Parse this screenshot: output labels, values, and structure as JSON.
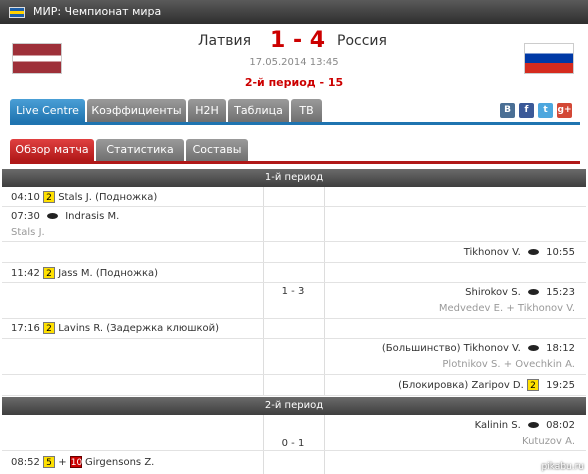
{
  "header": {
    "title": "МИР: Чемпионат мира"
  },
  "match": {
    "home": "Латвия",
    "away": "Россия",
    "score": "1 - 4",
    "datetime": "17.05.2014 13:45",
    "status": "2-й период - 15"
  },
  "tabs": [
    "Live Centre",
    "Коэффициенты",
    "H2H",
    "Таблица",
    "ТВ"
  ],
  "social": [
    "В",
    "f",
    "t",
    "g+"
  ],
  "subtabs": [
    "Обзор матча",
    "Статистика",
    "Составы"
  ],
  "periods": [
    {
      "label": "1-й период",
      "score": "1 - 3",
      "events": [
        {
          "time": "04:10",
          "badge": "2",
          "text": "Stals J. (Подножка)"
        },
        {
          "time": "07:30",
          "text": "Indrasis M.",
          "sub": "Stals J."
        },
        {
          "time": "10:55",
          "text": "Tikhonov V."
        },
        {
          "time": "11:42",
          "badge": "2",
          "text": "Jass M. (Подножка)"
        },
        {
          "time": "15:23",
          "text": "Shirokov S.",
          "sub": "Medvedev E. + Tikhonov V."
        },
        {
          "time": "17:16",
          "badge": "2",
          "text": "Lavins R. (Задержка клюшкой)"
        },
        {
          "time": "18:12",
          "text": "(Большинство) Tikhonov V.",
          "sub": "Plotnikov S. + Ovechkin A."
        },
        {
          "time": "19:25",
          "badge": "2",
          "text": "(Блокировка) Zaripov D."
        }
      ]
    },
    {
      "label": "2-й период",
      "score": "0 - 1",
      "events": [
        {
          "time": "08:02",
          "text": "Kalinin S.",
          "sub": "Kutuzov A."
        },
        {
          "time": "08:52",
          "badge": "5",
          "badge2": "10",
          "plus": "+",
          "text": "Girgensons Z."
        }
      ]
    }
  ],
  "watermark": "pikabu.ru"
}
